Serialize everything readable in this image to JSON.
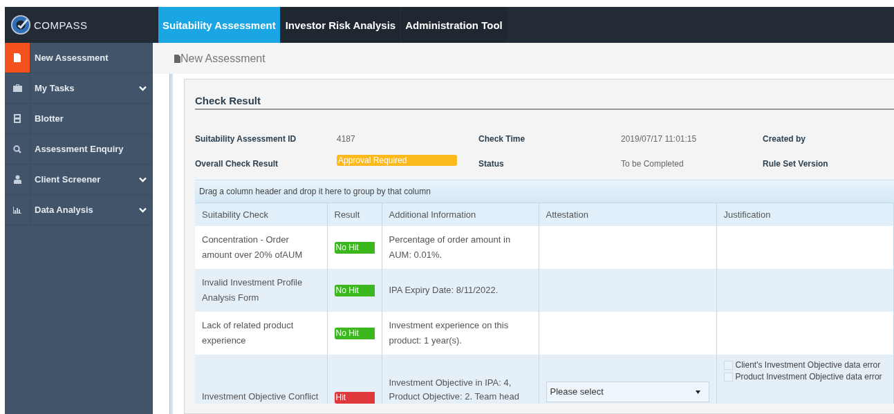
{
  "brand": {
    "name": "COMPASS"
  },
  "top_tabs": [
    {
      "label": "Suitability Assessment",
      "selected": true
    },
    {
      "label": "Investor Risk Analysis",
      "selected": false
    },
    {
      "label": "Administration Tool",
      "selected": false
    }
  ],
  "sidebar": {
    "items": [
      {
        "label": "New Assessment",
        "kind": "document",
        "selected": true,
        "expandable": false
      },
      {
        "label": "My Tasks",
        "kind": "briefcase",
        "selected": false,
        "expandable": true
      },
      {
        "label": "Blotter",
        "kind": "ledger",
        "selected": false,
        "expandable": false
      },
      {
        "label": "Assessment Enquiry",
        "kind": "search",
        "selected": false,
        "expandable": false
      },
      {
        "label": "Client Screener",
        "kind": "person",
        "selected": false,
        "expandable": true
      },
      {
        "label": "Data Analysis",
        "kind": "chart",
        "selected": false,
        "expandable": true
      }
    ]
  },
  "breadcrumb": {
    "title": "New Assessment"
  },
  "panel": {
    "title": "Check Result",
    "info": [
      {
        "label": "Suitability Assessment ID",
        "value": "4187",
        "kind": "text"
      },
      {
        "label": "Check Time",
        "value": "2019/07/17 11:01:15",
        "kind": "text"
      },
      {
        "label": "Created by",
        "kind": "text"
      },
      {
        "label": "Overall Check Result",
        "value": "Approval Required",
        "kind": "badge"
      },
      {
        "label": "Status",
        "value": "To be Completed",
        "kind": "text"
      },
      {
        "label": "Rule Set Version",
        "kind": "text"
      }
    ],
    "group_hint": "Drag a column header and drop it here to group by that column",
    "table": {
      "columns": [
        "Suitability Check",
        "Result",
        "Additional Information",
        "Attestation",
        "Justification"
      ],
      "rows": [
        {
          "check": "Concentration - Order amount over 20% ofAUM",
          "result": "No Hit",
          "hit": false,
          "info": "Percentage of order amount in AUM: 0.01%."
        },
        {
          "check": "Invalid Investment Profile Analysis Form",
          "result": "No Hit",
          "hit": false,
          "info": "IPA Expiry Date: 8/11/2022."
        },
        {
          "check": "Lack of related product experience",
          "result": "No Hit",
          "hit": false,
          "info": "Investment experience on this product: 1 year(s)."
        },
        {
          "check": "Investment Objective Conflict",
          "result": "Hit",
          "hit": true,
          "info": "Investment Objective in IPA: 4, Product Objective: 2. Team head",
          "attestation": {
            "value": "Please select"
          },
          "justification": [
            {
              "label": "Client's Investment Objective data error",
              "checked": false
            },
            {
              "label": "Product Investment Objective data error",
              "checked": false
            }
          ]
        }
      ]
    }
  }
}
